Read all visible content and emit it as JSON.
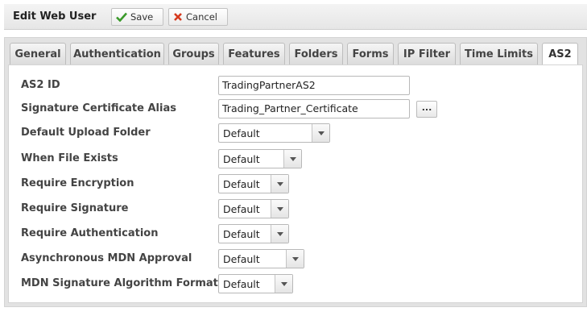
{
  "header": {
    "title": "Edit Web User",
    "save_label": "Save",
    "cancel_label": "Cancel"
  },
  "tabs": [
    {
      "label": "General"
    },
    {
      "label": "Authentication"
    },
    {
      "label": "Groups"
    },
    {
      "label": "Features"
    },
    {
      "label": "Folders"
    },
    {
      "label": "Forms"
    },
    {
      "label": "IP Filter"
    },
    {
      "label": "Time Limits"
    },
    {
      "label": "AS2"
    }
  ],
  "active_tab": "AS2",
  "form": {
    "as2_id": {
      "label": "AS2 ID",
      "value": "TradingPartnerAS2"
    },
    "sig_cert_alias": {
      "label": "Signature Certificate Alias",
      "value": "Trading_Partner_Certificate",
      "browse_label": "..."
    },
    "upload_folder": {
      "label": "Default Upload Folder",
      "value": "Default"
    },
    "file_exists": {
      "label": "When File Exists",
      "value": "Default"
    },
    "require_encryption": {
      "label": "Require Encryption",
      "value": "Default"
    },
    "require_signature": {
      "label": "Require Signature",
      "value": "Default"
    },
    "require_auth": {
      "label": "Require Authentication",
      "value": "Default"
    },
    "async_mdn": {
      "label": "Asynchronous MDN Approval",
      "value": "Default"
    },
    "mdn_sig_alg": {
      "label": "MDN Signature Algorithm Format",
      "value": "Default"
    }
  }
}
